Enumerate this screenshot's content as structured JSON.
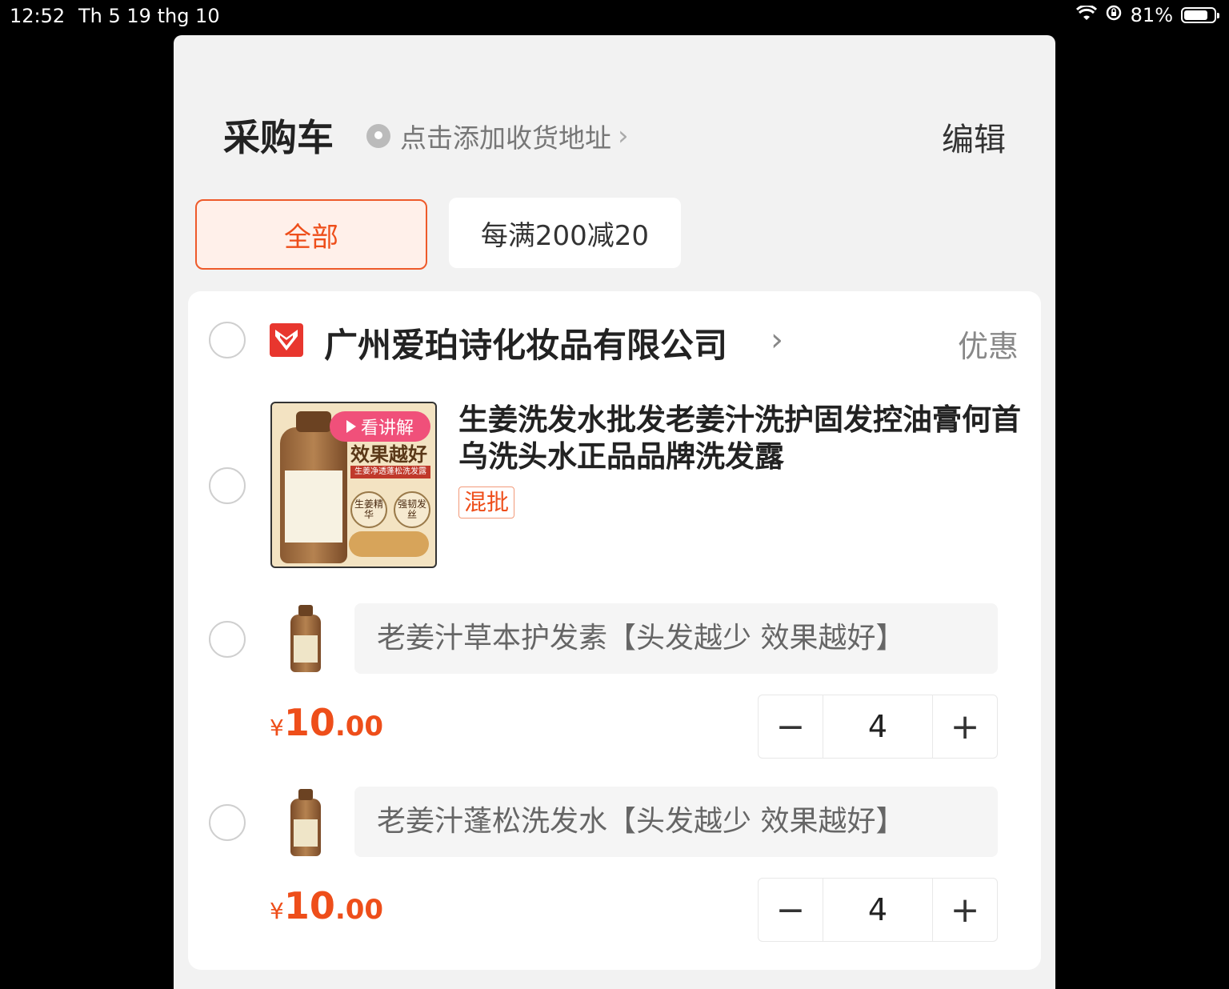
{
  "status": {
    "time": "12:52",
    "date": "Th 5 19 thg 10",
    "battery": "81%",
    "battery_level": 0.81
  },
  "header": {
    "title": "采购车",
    "address_prompt": "点击添加收货地址",
    "edit_label": "编辑"
  },
  "filters": {
    "all_label": "全部",
    "promo_label": "每满200减20"
  },
  "shop": {
    "name": "广州爱珀诗化妆品有限公司",
    "discount_label": "优惠",
    "product": {
      "title": "生姜洗发水批发老姜汁洗护固发控油膏何首乌洗头水正品品牌洗发露",
      "video_tag": "看讲解",
      "mix_tag": "混批",
      "image_text": {
        "headline": "效果越好",
        "stripe": "生姜净透蓬松洗发露",
        "badge1": "生姜精华",
        "badge2": "强韧发丝"
      },
      "skus": [
        {
          "name": "老姜汁草本护发素【头发越少 效果越好】",
          "currency": "¥",
          "price_int": "10",
          "price_dec": ".00",
          "quantity": "4",
          "minus": "−",
          "plus": "+"
        },
        {
          "name": "老姜汁蓬松洗发水【头发越少 效果越好】",
          "currency": "¥",
          "price_int": "10",
          "price_dec": ".00",
          "quantity": "4",
          "minus": "−",
          "plus": "+"
        }
      ]
    }
  },
  "colors": {
    "accent": "#ee4e1a",
    "background": "#f2f2f2",
    "card": "#ffffff"
  },
  "icons": [
    "wifi-icon",
    "rotation-lock-icon",
    "battery-icon",
    "location-pin-icon",
    "chevron-right-icon",
    "shop-logo-icon",
    "play-icon",
    "minus-icon",
    "plus-icon"
  ]
}
